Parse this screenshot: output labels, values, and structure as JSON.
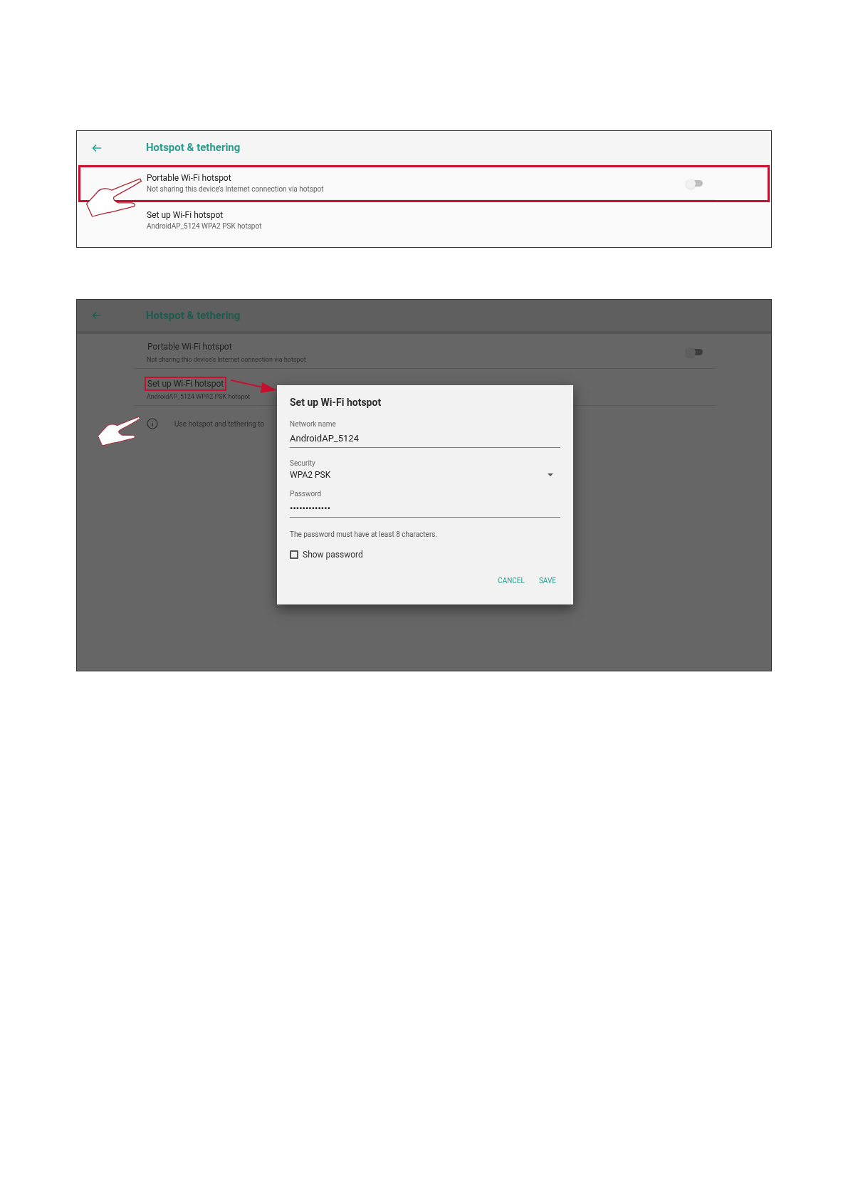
{
  "screens": [
    {
      "kind": "plain",
      "title": "Hotspot & tethering",
      "items": [
        {
          "kind": "toggle",
          "title": "Portable Wi-Fi hotspot",
          "subtitle": "Not sharing this device’s Internet connection via hotspot",
          "on": false,
          "highlighted": true
        },
        {
          "kind": "link",
          "title": "Set up Wi-Fi hotspot",
          "subtitle": "AndroidAP_5124 WPA2 PSK hotspot",
          "highlighted": false
        }
      ]
    },
    {
      "kind": "dimmed",
      "title": "Hotspot & tethering",
      "items": [
        {
          "kind": "toggle",
          "title": "Portable Wi-Fi hotspot",
          "subtitle": "Not sharing this device’s Internet connection via hotspot",
          "on": false,
          "highlighted": false
        },
        {
          "kind": "link",
          "title": "Set up Wi-Fi hotspot",
          "subtitle": "AndroidAP_5124 WPA2 PSK hotspot",
          "highlighted": true
        }
      ],
      "info": "Use hotspot and tethering to",
      "dialog": {
        "title": "Set up Wi-Fi hotspot",
        "fields": [
          {
            "kind": "text",
            "label": "Network name",
            "value": "AndroidAP_5124"
          },
          {
            "kind": "select",
            "label": "Security",
            "value": "WPA2 PSK"
          },
          {
            "kind": "text",
            "label": "Password",
            "value": "•••••••••••••"
          }
        ],
        "hint": "The password must have at least 8 characters.",
        "checkbox": {
          "label": "Show password",
          "checked": false
        },
        "buttons": [
          "CANCEL",
          "SAVE"
        ]
      }
    }
  ]
}
